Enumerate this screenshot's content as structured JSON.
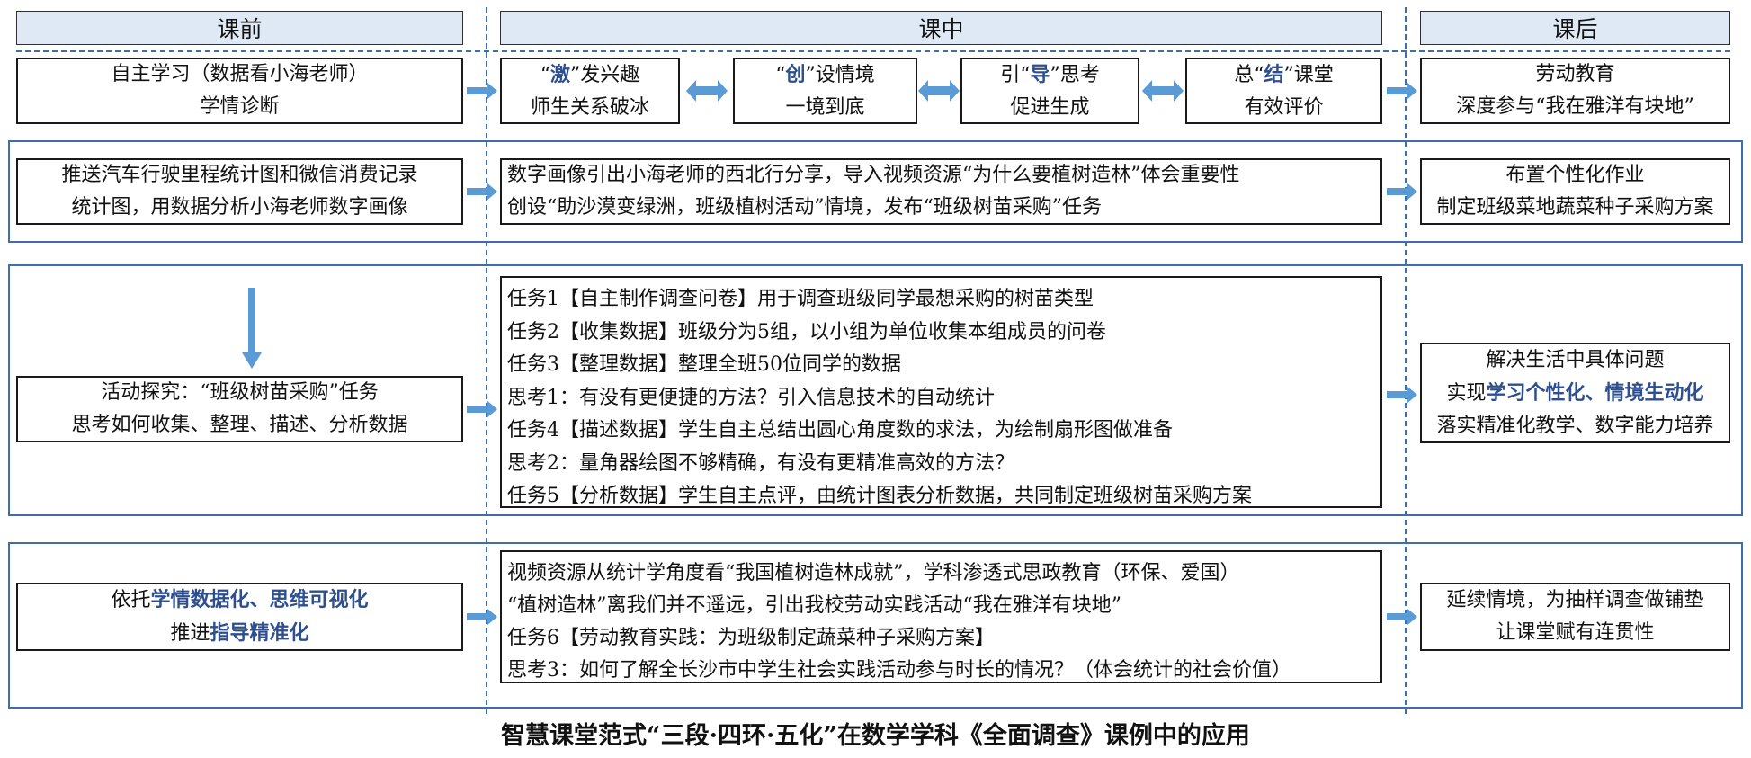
{
  "headers": {
    "before": "课前",
    "during": "课中",
    "after": "课后"
  },
  "row1": {
    "self_study": [
      "自主学习（数据看小海老师）",
      "学情诊断"
    ],
    "stages": [
      {
        "pre": "“",
        "key": "激",
        "post": "”发兴趣",
        "line2": "师生关系破冰"
      },
      {
        "pre": "“",
        "key": "创",
        "post": "”设情境",
        "line2": "一境到底"
      },
      {
        "pre": "引“",
        "key": "导",
        "post": "”思考",
        "line2": "促进生成"
      },
      {
        "pre": "总“",
        "key": "结",
        "post": "”课堂",
        "line2": "有效评价"
      }
    ],
    "labor": [
      "劳动教育",
      "深度参与“我在雅洋有块地”"
    ]
  },
  "row2": {
    "left": [
      "推送汽车行驶里程统计图和微信消费记录",
      "统计图，用数据分析小海老师数字画像"
    ],
    "mid": [
      "数字画像引出小海老师的西北行分享，导入视频资源“为什么要植树造林”体会重要性",
      "创设“助沙漠变绿洲，班级植树活动”情境，发布“班级树苗采购”任务"
    ],
    "right": [
      "布置个性化作业",
      "制定班级菜地蔬菜种子采购方案"
    ]
  },
  "row3": {
    "left": [
      "活动探究：“班级树苗采购”任务",
      "思考如何收集、整理、描述、分析数据"
    ],
    "tasks": [
      "任务1【自主制作调查问卷】用于调查班级同学最想采购的树苗类型",
      "任务2【收集数据】班级分为5组，以小组为单位收集本组成员的问卷",
      "任务3【整理数据】整理全班50位同学的数据",
      "思考1：有没有更便捷的方法？引入信息技术的自动统计",
      "任务4【描述数据】学生自主总结出圆心角度数的求法，为绘制扇形图做准备",
      "思考2：量角器绘图不够精确，有没有更精准高效的方法？",
      "任务5【分析数据】学生自主点评，由统计图表分析数据，共同制定班级树苗采购方案"
    ],
    "right": {
      "line1": "解决生活中具体问题",
      "line2_pre": "实现",
      "line2_hi": "学习个性化、情境生动化",
      "line3": "落实精准化教学、数字能力培养"
    }
  },
  "row4": {
    "left": {
      "l1_pre": "依托",
      "l1_hi": "学情数据化、思维可视化",
      "l2_pre": "推进",
      "l2_hi": "指导精准化"
    },
    "tasks": [
      "视频资源从统计学角度看“我国植树造林成就”，学科渗透式思政教育（环保、爱国）",
      "“植树造林”离我们并不遥远，引出我校劳动实践活动“我在雅洋有块地”",
      "任务6【劳动教育实践：为班级制定蔬菜种子采购方案】",
      "思考3：如何了解全长沙市中学生社会实践活动参与时长的情况？（体会统计的社会价值）"
    ],
    "right": [
      "延续情境，为抽样调查做铺垫",
      "让课堂赋有连贯性"
    ]
  },
  "caption": "智慧课堂范式“三段·四环·五化”在数学学科《全面调查》课例中的应用",
  "colors": {
    "accent": "#3d6fa8",
    "arrow": "#5b9bd5",
    "header_bg": "#dfe9f5",
    "highlight": "#2e4f8f"
  },
  "icons": {
    "flow_arrow": "right-arrow-icon",
    "double_arrow": "double-arrow-icon",
    "down_arrow": "down-arrow-icon"
  }
}
